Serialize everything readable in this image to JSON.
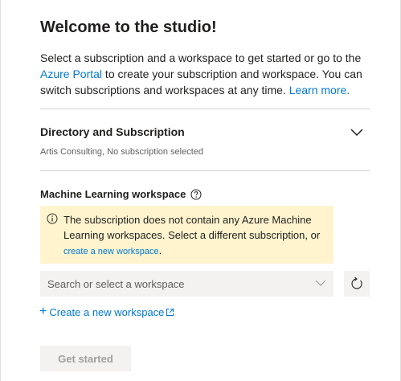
{
  "dialog": {
    "title": "Welcome to the studio!",
    "intro": {
      "part1": "Select a subscription and a workspace to get started or go to the ",
      "portal_link": "Azure Portal",
      "part2": " to create your subscription and workspace. You can switch subscriptions and workspaces at any time. ",
      "learn_more": "Learn more."
    }
  },
  "directory": {
    "title": "Directory and Subscription",
    "subtitle": "Artis Consulting, No subscription selected",
    "chevron_icon": "chevron-down-icon"
  },
  "workspace": {
    "label": "Machine Learning workspace",
    "help_icon": "help-circle-icon",
    "warning": {
      "icon": "info-icon",
      "text": "The subscription does not contain any Azure Machine Learning workspaces. Select a different subscription, or ",
      "link": "create a new workspace",
      "end": "."
    },
    "select_placeholder": "Search or select a workspace",
    "refresh_icon": "refresh-icon",
    "create_label": "Create a new workspace"
  },
  "actions": {
    "get_started": "Get started"
  }
}
